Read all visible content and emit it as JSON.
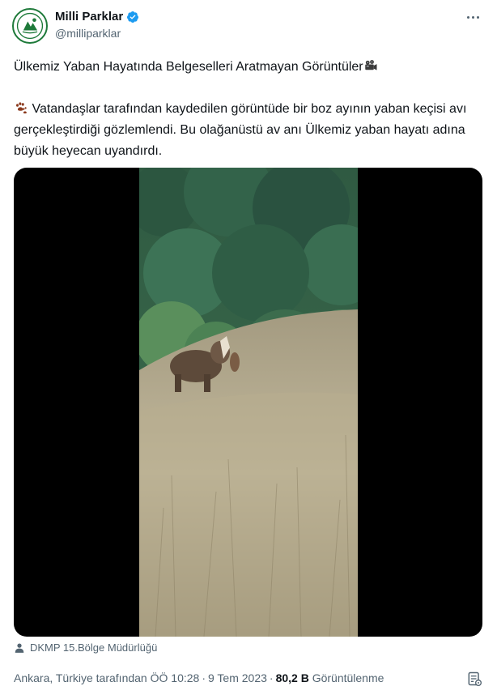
{
  "account": {
    "display_name": "Milli Parklar",
    "handle": "@milliparklar",
    "verified_icon": "verified-badge-icon",
    "avatar_icon": "milli-parklar-logo",
    "brand_color": "#1e7a3a",
    "verified_color": "#1d9bf0"
  },
  "post": {
    "title": "Ülkemiz Yaban Hayatında Belgeselleri Aratmayan Görüntüler",
    "title_emoji": "movie-camera-icon",
    "body_emoji": "paw-prints-icon",
    "body": "Vatandaşlar tarafından kaydedilen görüntüde bir boz ayının yaban keçisi avı gerçekleştirdiği gözlemlendi. Bu olağanüstü av anı Ülkemiz yaban hayatı adına büyük heyecan uyandırdı."
  },
  "media": {
    "type": "video",
    "description_icon": "video-thumbnail"
  },
  "credit": {
    "label": "DKMP 15.Bölge Müdürlüğü",
    "icon": "person-icon"
  },
  "meta": {
    "location_time": "Ankara, Türkiye tarafından ÖÖ 10:28",
    "separator": "·",
    "date": "9 Tem 2023",
    "views_count": "80,2 B",
    "views_label": "Görüntülenme",
    "analytics_icon": "analytics-icon"
  },
  "colors": {
    "text_primary": "#0f1419",
    "text_secondary": "#536471",
    "background": "#ffffff"
  }
}
